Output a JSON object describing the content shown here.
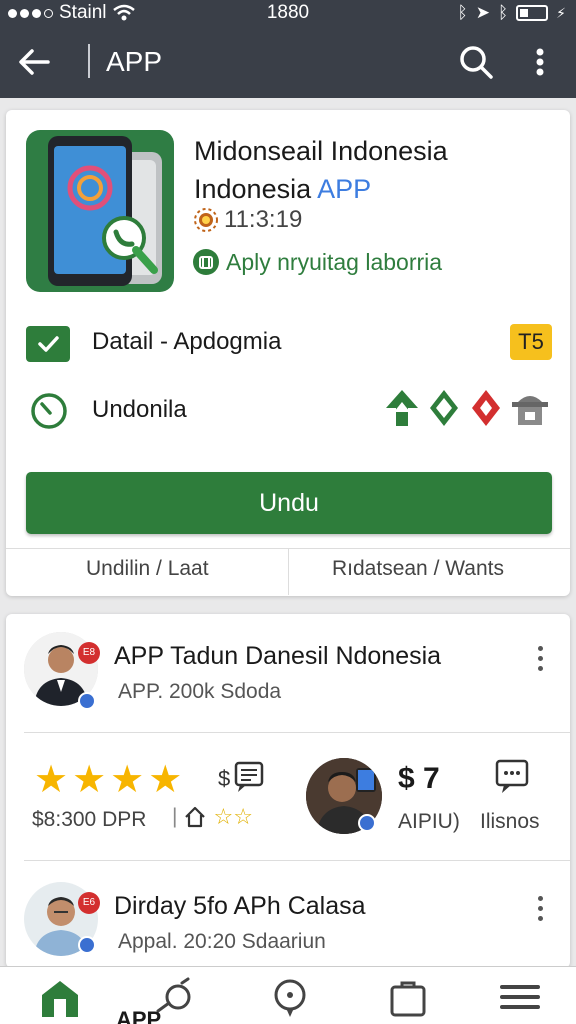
{
  "status_bar": {
    "carrier": "Stainl",
    "time": "1880"
  },
  "app_bar": {
    "title": "APP"
  },
  "app_card": {
    "name_line1": "Midonseail Indonesia",
    "name_line2_prefix": "Indonesia ",
    "name_line2_accent": "APP",
    "meta_time": "11:3:19",
    "meta_apply": "Aply nryuitag laborria",
    "detail_label": "Datail - Apdogmia",
    "badge": "T5",
    "undo_label": "Undonila",
    "download_label": "Undu",
    "tab_left": "Undilin / Laat",
    "tab_right": "Rıdatsean / Wants"
  },
  "list": {
    "item1": {
      "title": "APP Tadun Danesil Ndonesia",
      "subtitle": "APP. 200k Sdoda",
      "badge": "E8"
    },
    "rating": {
      "stars": 4,
      "dpr_text": "$8:300 DPR",
      "price": "$ 7",
      "price_label": "AIPIU)",
      "chat_label": "Ilisnos"
    },
    "item2": {
      "title": "Dirday 5fo APh Calasa",
      "subtitle": "Appal. 20:20 Sdaariun",
      "badge": "E6"
    }
  },
  "bottom_nav": {
    "label": "APP"
  },
  "colors": {
    "appbar": "#3a3f48",
    "primary": "#2e7d3b",
    "accent": "#3d7de0",
    "badge": "#f6c01d",
    "star": "#f7b500"
  }
}
